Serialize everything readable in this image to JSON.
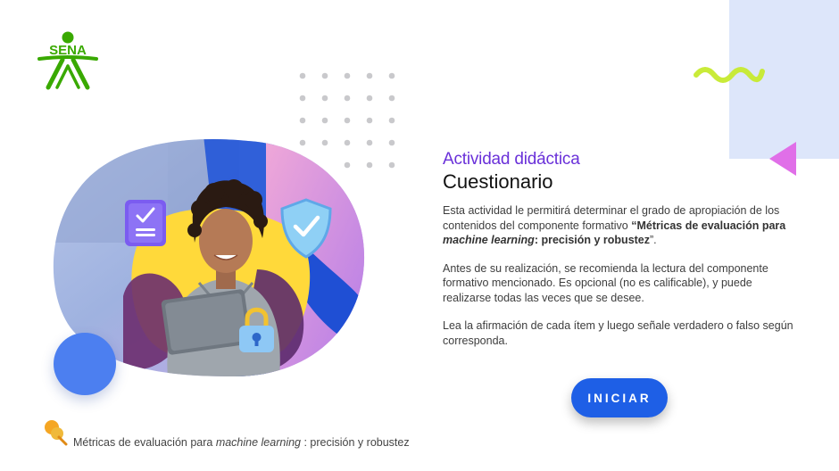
{
  "logo": {
    "text": "SENA",
    "color": "#39a900"
  },
  "content": {
    "eyebrow": "Actividad didáctica",
    "title": "Cuestionario",
    "p1_start": "Esta actividad le permitirá determinar el grado de apropiación de los contenidos del componente formativo ",
    "p1_bold_start": "“Métricas de evaluación para ",
    "p1_bold_italic": "machine learning",
    "p1_bold_end": ": precisión y robustez",
    "p1_end": "”.",
    "p2": "Antes de su realización, se recomienda la lectura del componente formativo mencionado. Es opcional (no es calificable), y puede realizarse todas las veces que se desee.",
    "p3": "Lea la afirmación de cada ítem y luego señale verdadero o falso según corresponda."
  },
  "start_button": {
    "label": "INICIAR"
  },
  "footer": {
    "prefix": "Métricas de evaluación para ",
    "italic": "machine learning",
    "suffix": " : precisión y robustez"
  },
  "colors": {
    "accent_purple": "#6a31d9",
    "button_blue": "#1e5fe6",
    "panel_bg": "#dde6fa",
    "squiggle": "#c6ea2e",
    "triangle": "#e06fe8",
    "footer_pin": "#f5a623"
  },
  "icons": [
    "sena-logo-icon",
    "checklist-icon",
    "shield-check-icon",
    "padlock-icon",
    "pushpin-icon"
  ]
}
